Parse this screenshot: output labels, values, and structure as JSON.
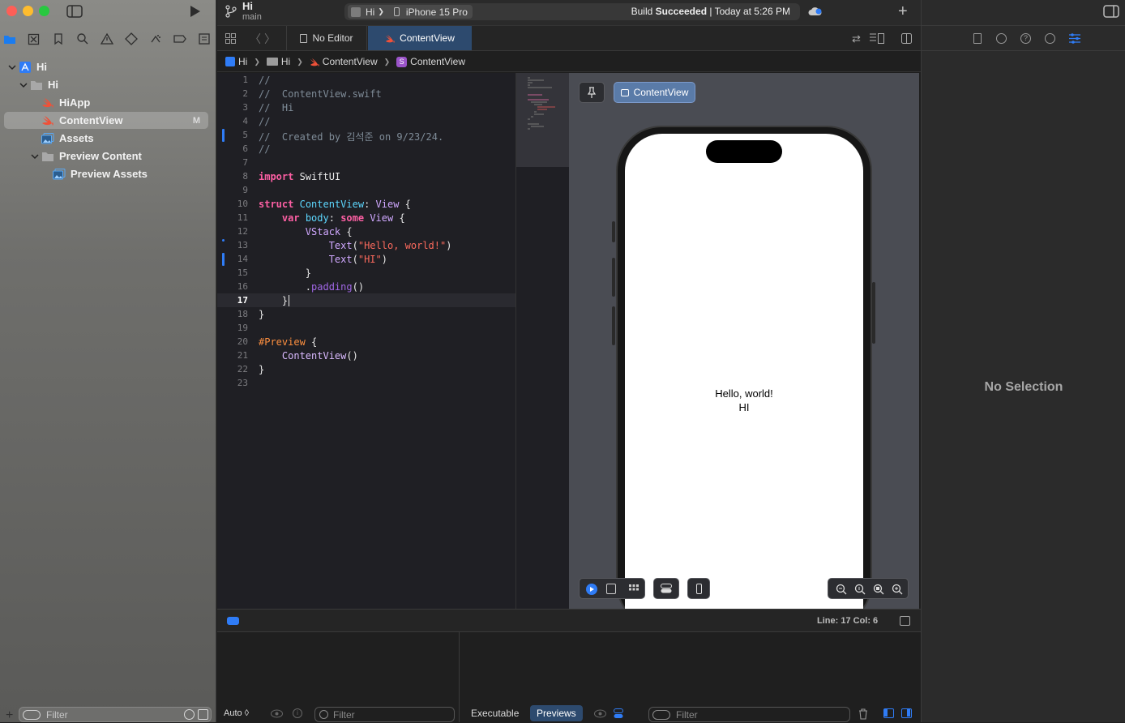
{
  "window": {
    "project_name": "Hi",
    "branch": "main",
    "scheme": "Hi",
    "destination": "iPhone 15 Pro",
    "build_status_prefix": "Build ",
    "build_status_bold": "Succeeded",
    "build_status_suffix": " | Today at 5:26 PM"
  },
  "navigator": {
    "items": [
      {
        "label": "Hi",
        "depth": 0,
        "kind": "project"
      },
      {
        "label": "Hi",
        "depth": 1,
        "kind": "folder"
      },
      {
        "label": "HiApp",
        "depth": 2,
        "kind": "swift"
      },
      {
        "label": "ContentView",
        "depth": 2,
        "kind": "swift",
        "badge": "M",
        "selected": true
      },
      {
        "label": "Assets",
        "depth": 2,
        "kind": "assets"
      },
      {
        "label": "Preview Content",
        "depth": 2,
        "kind": "folder"
      },
      {
        "label": "Preview Assets",
        "depth": 3,
        "kind": "assets"
      }
    ],
    "filter_placeholder": "Filter"
  },
  "tabs": [
    {
      "label": "No Editor",
      "active": false
    },
    {
      "label": "ContentView",
      "active": true
    }
  ],
  "breadcrumb": [
    "Hi",
    "Hi",
    "ContentView",
    "ContentView"
  ],
  "editor": {
    "line_numbers": [
      "1",
      "2",
      "3",
      "4",
      "5",
      "6",
      "7",
      "8",
      "9",
      "10",
      "11",
      "12",
      "13",
      "14",
      "15",
      "16",
      "17",
      "18",
      "19",
      "20",
      "21",
      "22",
      "23"
    ],
    "current_line": 17,
    "code_lines": [
      "//",
      "//  ContentView.swift",
      "//  Hi",
      "//",
      "//  Created by 김석준 on 9/23/24.",
      "//",
      "",
      "import SwiftUI",
      "",
      "struct ContentView: View {",
      "    var body: some View {",
      "        VStack {",
      "            Text(\"Hello, world!\")",
      "            Text(\"HI\")",
      "        }",
      "        .padding()",
      "    }",
      "}",
      "",
      "#Preview {",
      "    ContentView()",
      "}",
      ""
    ]
  },
  "preview": {
    "pin_label": "",
    "view_button": "ContentView",
    "text_line_1": "Hello, world!",
    "text_line_2": "HI"
  },
  "status": {
    "line_col": "Line: 17  Col: 6"
  },
  "debug": {
    "auto_label": "Auto ◊",
    "filter_placeholder": "Filter",
    "executable_tab": "Executable",
    "previews_tab": "Previews"
  },
  "inspector": {
    "empty_label": "No Selection"
  },
  "colors": {
    "accent": "#2f7cf6",
    "selection_tab": "#2d4a6e"
  }
}
